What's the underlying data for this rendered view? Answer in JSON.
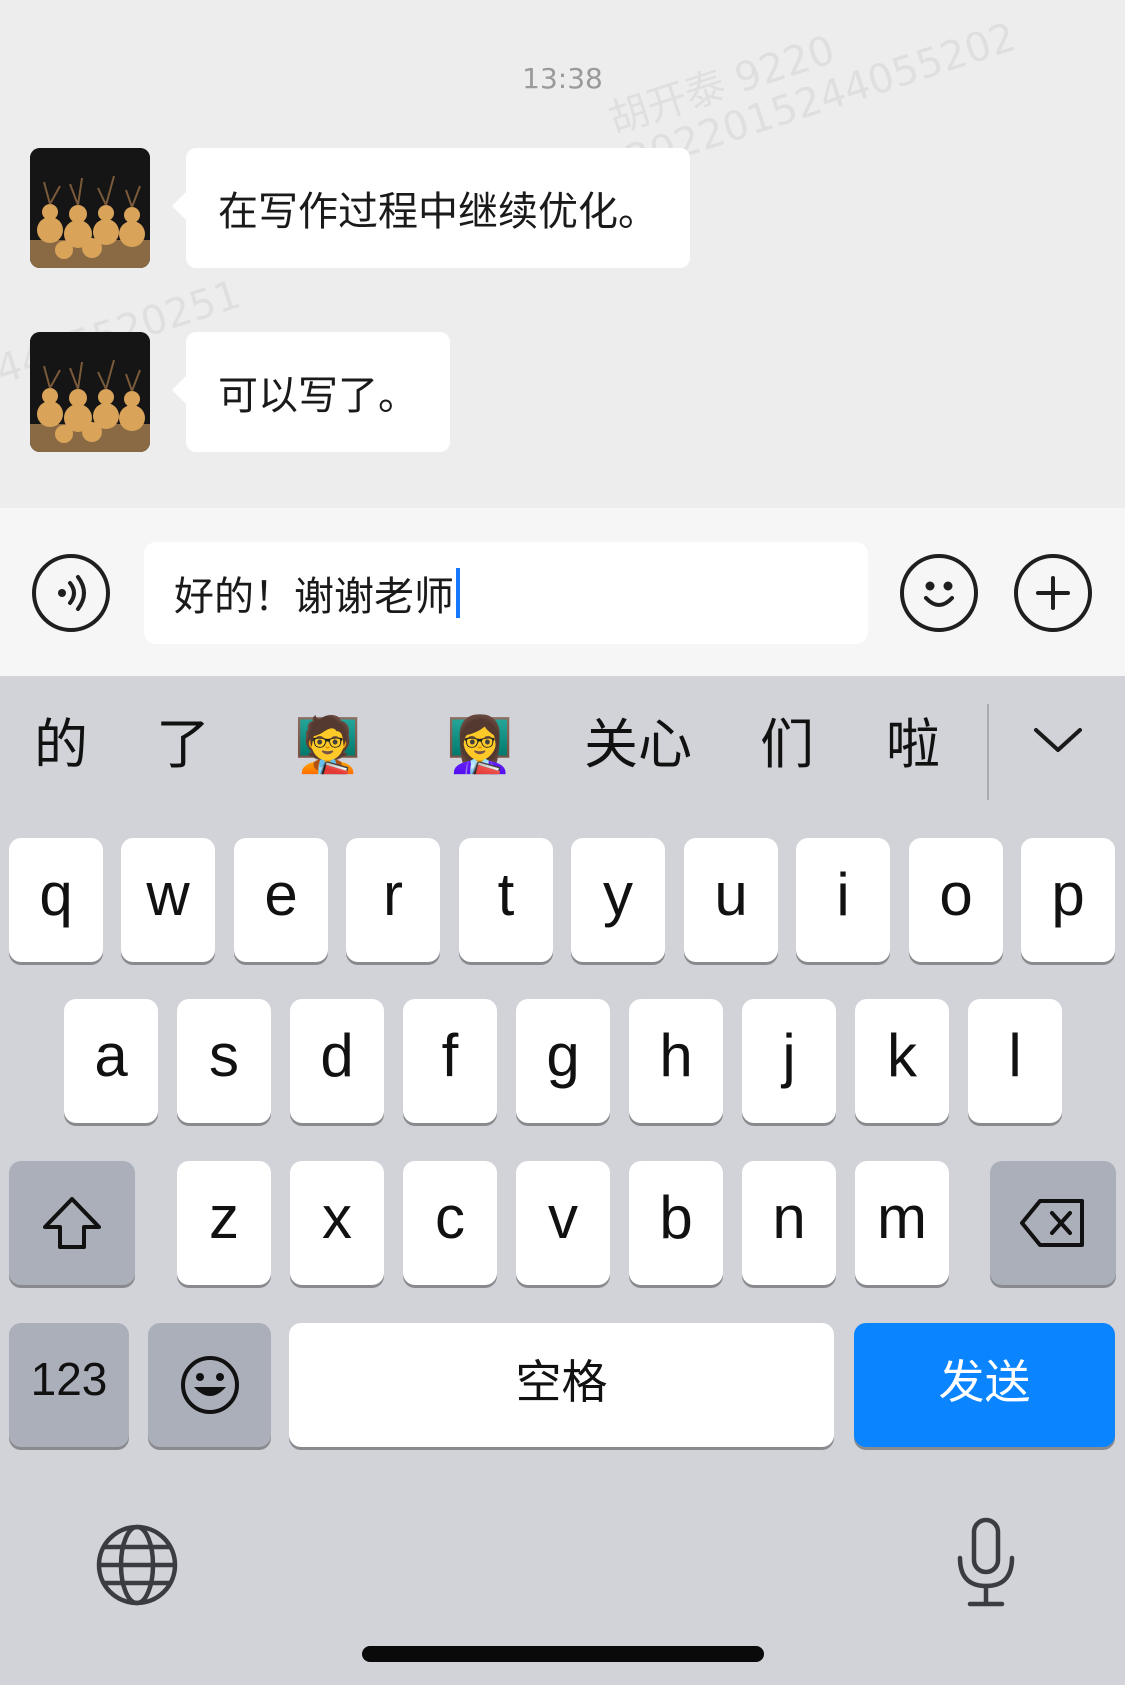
{
  "chat": {
    "watermark": {
      "line1": "胡开泰 9220",
      "line2": "2022015244055202",
      "line3": "4405520251"
    },
    "timestamp": "13:38",
    "messages": [
      {
        "text": "在写作过程中继续优化。"
      },
      {
        "text": "可以写了。"
      }
    ]
  },
  "input": {
    "value": "好的！谢谢老师",
    "voice_icon": "voice-icon",
    "emoji_icon": "smiley-icon",
    "plus_icon": "plus-icon"
  },
  "candidates": {
    "items": [
      "的",
      "了",
      "🧑‍🏫",
      "👩‍🏫",
      "关心",
      "们",
      "啦"
    ],
    "collapse_icon": "chevron-down-icon"
  },
  "keyboard": {
    "row1": [
      "q",
      "w",
      "e",
      "r",
      "t",
      "y",
      "u",
      "i",
      "o",
      "p"
    ],
    "row2": [
      "a",
      "s",
      "d",
      "f",
      "g",
      "h",
      "j",
      "k",
      "l"
    ],
    "row3": [
      "z",
      "x",
      "c",
      "v",
      "b",
      "n",
      "m"
    ],
    "numbers_label": "123",
    "space_label": "空格",
    "send_label": "发送",
    "accent_color": "#0a84ff"
  }
}
